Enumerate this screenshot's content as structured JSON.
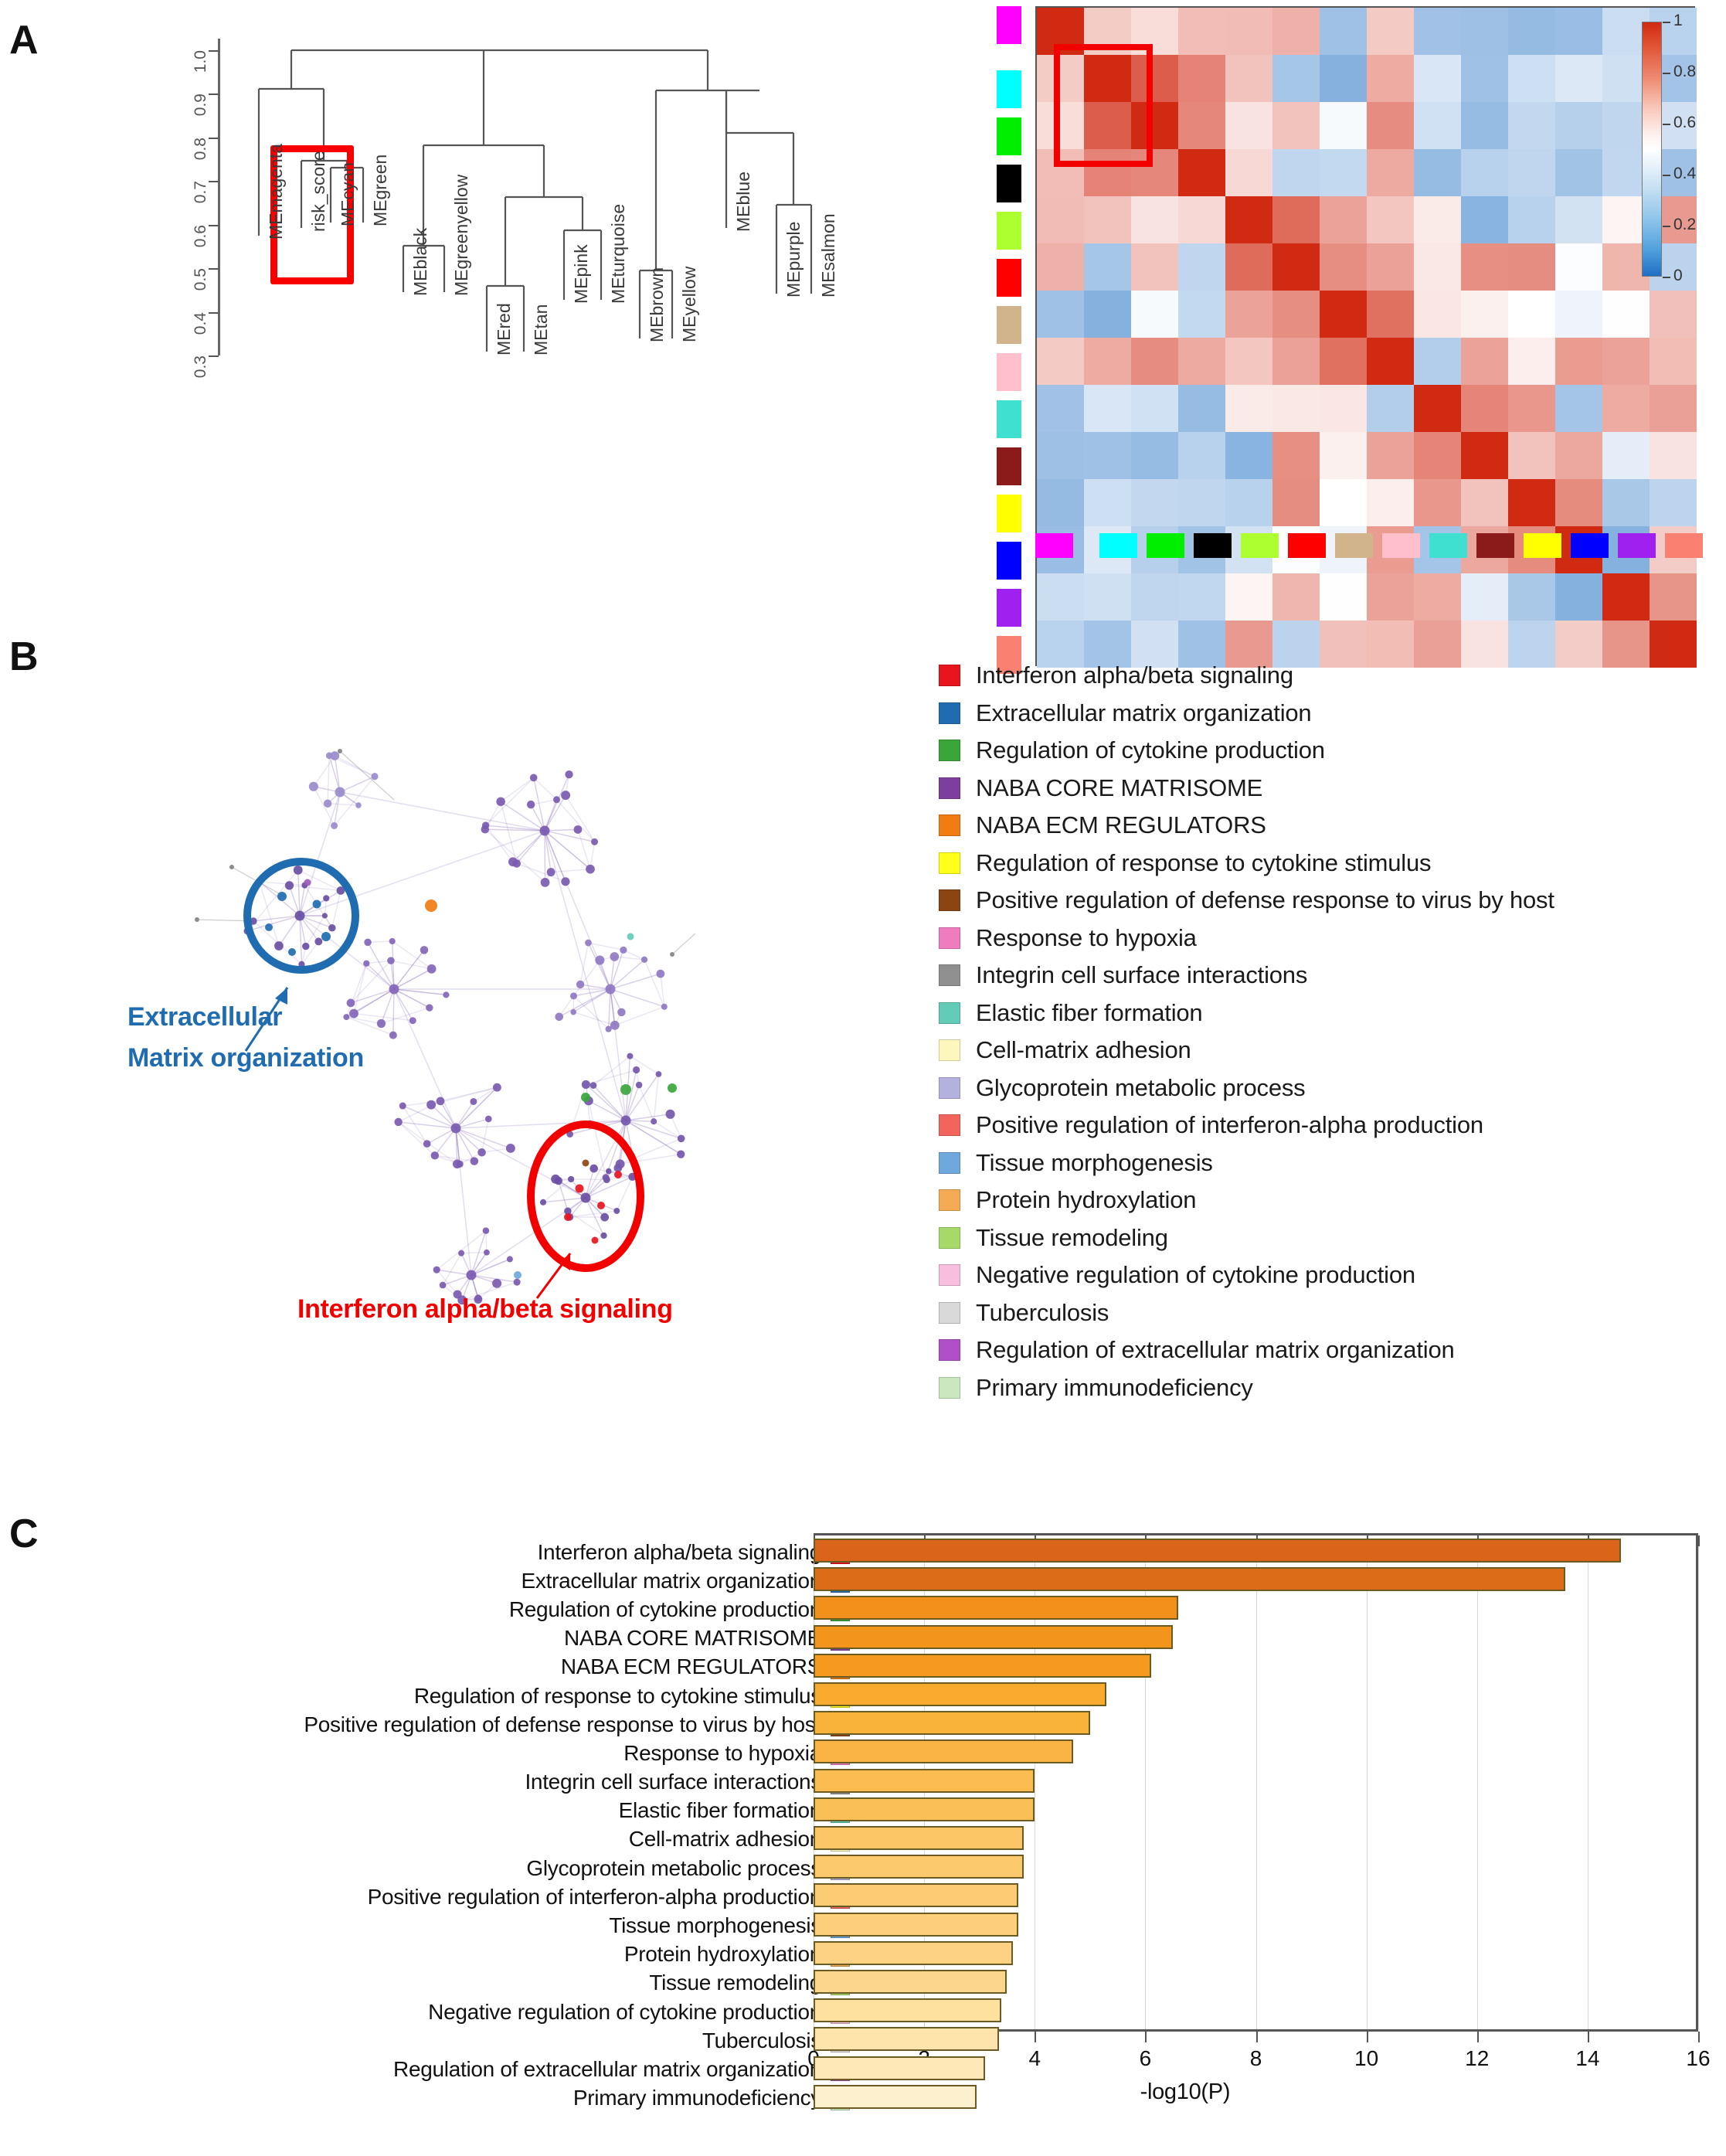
{
  "panels": {
    "a": "A",
    "b": "B",
    "c": "C"
  },
  "panel_a": {
    "dendrogram": {
      "y_ticks": [
        "1.0",
        "0.9",
        "0.8",
        "0.7",
        "0.6",
        "0.5",
        "0.4",
        "0.3"
      ],
      "leaves": [
        "MEmagenta",
        "risk_score",
        "MEcyan",
        "MEgreen",
        "MEblack",
        "MEgreenyellow",
        "MEred",
        "MEtan",
        "MEpink",
        "MEturquoise",
        "MEbrown",
        "MEyellow",
        "MEblue",
        "MEpurple",
        "MEsalmon"
      ],
      "highlight_box": "risk_score-MEcyan-MEgreen cluster"
    },
    "heatmap": {
      "colorbar_ticks": [
        "1",
        "0.8",
        "0.6",
        "0.4",
        "0.2",
        "0"
      ],
      "module_colors": [
        "#ff00ff",
        "#00ffff",
        "#00ee00",
        "#000000",
        "#adff2f",
        "#ff0000",
        "#d2b48c",
        "#ffc0cb",
        "#40e0d0",
        "#8b1a1a",
        "#ffff00",
        "#0000ff",
        "#a020f0",
        "#fa8072"
      ],
      "module_names": [
        "magenta",
        "cyan",
        "green",
        "black",
        "greenyellow",
        "red",
        "tan",
        "pink",
        "turquoise",
        "brown",
        "yellow",
        "blue",
        "purple",
        "salmon"
      ]
    }
  },
  "panel_b": {
    "annotation_ecm_line1": "Extracellular",
    "annotation_ecm_line2": "Matrix organization",
    "annotation_ifn": "Interferon alpha/beta signaling",
    "annotation_ecm_color": "#1f6cb0",
    "annotation_ifn_color": "#f20000",
    "legend": [
      {
        "label": "Interferon alpha/beta signaling",
        "color": "#e8141e"
      },
      {
        "label": "Extracellular matrix organization",
        "color": "#1f6cb0"
      },
      {
        "label": "Regulation of cytokine production",
        "color": "#3aa63a"
      },
      {
        "label": "NABA CORE MATRISOME",
        "color": "#7d3f9e"
      },
      {
        "label": "NABA ECM REGULATORS",
        "color": "#f07c12"
      },
      {
        "label": "Regulation of response to cytokine stimulus",
        "color": "#ffff1a"
      },
      {
        "label": "Positive regulation of defense response to virus by host",
        "color": "#8b4513"
      },
      {
        "label": "Response to hypoxia",
        "color": "#f07cc0"
      },
      {
        "label": "Integrin cell surface interactions",
        "color": "#909090"
      },
      {
        "label": "Elastic fiber formation",
        "color": "#63ccb9"
      },
      {
        "label": "Cell-matrix adhesion",
        "color": "#fdf7bd"
      },
      {
        "label": "Glycoprotein metabolic process",
        "color": "#b3b1de"
      },
      {
        "label": "Positive regulation of interferon-alpha production",
        "color": "#f2645c"
      },
      {
        "label": "Tissue morphogenesis",
        "color": "#6fa8dc"
      },
      {
        "label": "Protein hydroxylation",
        "color": "#f5aa55"
      },
      {
        "label": "Tissue remodeling",
        "color": "#a6d96a"
      },
      {
        "label": "Negative regulation of cytokine production",
        "color": "#f7bfdd"
      },
      {
        "label": "Tuberculosis",
        "color": "#d9d9d9"
      },
      {
        "label": "Regulation of extracellular matrix organization",
        "color": "#b050c8"
      },
      {
        "label": "Primary immunodeficiency",
        "color": "#c9e8c0"
      }
    ]
  },
  "chart_data": {
    "type": "bar",
    "title": "",
    "xlabel": "-log10(P)",
    "ylabel": "",
    "xlim": [
      0,
      16
    ],
    "x_ticks": [
      0,
      2,
      4,
      6,
      8,
      10,
      12,
      14,
      16
    ],
    "grid": true,
    "orientation": "horizontal",
    "categories": [
      "Interferon alpha/beta signaling",
      "Extracellular matrix organization",
      "Regulation of cytokine production",
      "NABA CORE MATRISOME",
      "NABA ECM REGULATORS",
      "Regulation of response to cytokine stimulus",
      "Positive regulation of defense response to virus by host",
      "Response to hypoxia",
      "Integrin cell surface interactions",
      "Elastic fiber formation",
      "Cell-matrix adhesion",
      "Glycoprotein metabolic process",
      "Positive regulation of interferon-alpha production",
      "Tissue morphogenesis",
      "Protein hydroxylation",
      "Tissue remodeling",
      "Negative regulation of cytokine production",
      "Tuberculosis",
      "Regulation of extracellular matrix organization",
      "Primary immunodeficiency"
    ],
    "values": [
      14.6,
      13.6,
      6.6,
      6.5,
      6.1,
      5.3,
      5.0,
      4.7,
      4.0,
      4.0,
      3.8,
      3.8,
      3.7,
      3.7,
      3.6,
      3.5,
      3.4,
      3.35,
      3.1,
      2.95
    ],
    "bar_colors": [
      "#d9641a",
      "#dd6c19",
      "#f1901b",
      "#f3951d",
      "#f59a1f",
      "#f8ab2e",
      "#f9b23a",
      "#fab445",
      "#fbbc52",
      "#fbbf58",
      "#fcc666",
      "#fcc96d",
      "#fccc74",
      "#fdcf7b",
      "#fdd284",
      "#fdd68e",
      "#fee09f",
      "#fee4ab",
      "#fee8b8",
      "#fdf0cf"
    ],
    "swatch_colors": [
      "#e8141e",
      "#1f6cb0",
      "#3aa63a",
      "#7d3f9e",
      "#f07c12",
      "#ffff1a",
      "#8b4513",
      "#f07cc0",
      "#909090",
      "#63ccb9",
      "#fdf7bd",
      "#b3b1de",
      "#f2645c",
      "#6fa8dc",
      "#f5aa55",
      "#a6d96a",
      "#f7bfdd",
      "#d9d9d9",
      "#b050c8",
      "#c9e8c0"
    ]
  }
}
